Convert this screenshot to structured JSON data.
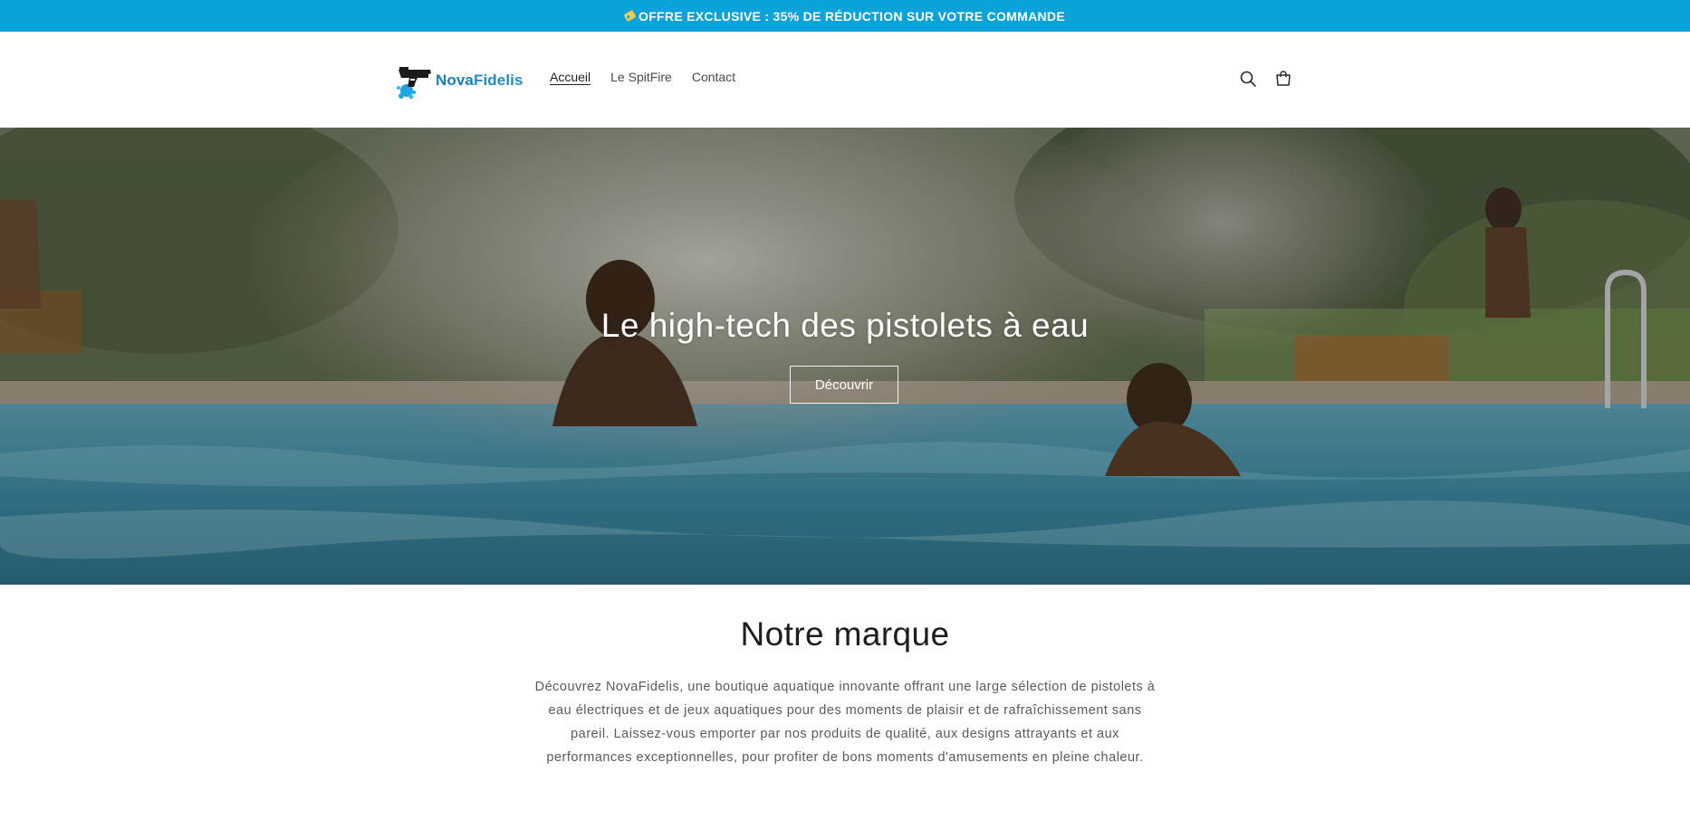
{
  "announcement": {
    "icon": "price-tag-icon",
    "text": "OFFRE EXCLUSIVE : 35% DE RÉDUCTION SUR VOTRE COMMANDE"
  },
  "header": {
    "logo": {
      "text_part1": "Nova",
      "text_part2": "Fidelis"
    },
    "nav": [
      {
        "label": "Accueil",
        "active": true
      },
      {
        "label": "Le SpitFire",
        "active": false
      },
      {
        "label": "Contact",
        "active": false
      }
    ],
    "icons": [
      "search-icon",
      "cart-icon"
    ]
  },
  "hero": {
    "title": "Le high-tech des pistolets à eau",
    "button_label": "Découvrir"
  },
  "brand": {
    "title": "Notre marque",
    "text": "Découvrez NovaFidelis, une boutique aquatique innovante offrant une large sélection de pistolets à eau électriques et de jeux aquatiques pour des moments de plaisir et de rafraîchissement sans pareil. Laissez-vous emporter par nos produits de qualité, aux designs attrayants et aux performances exceptionnelles, pour profiter de bons moments d'amusements en pleine chaleur."
  },
  "colors": {
    "announcement_bg": "#0aa3d9",
    "brand_blue": "#1d8fc7"
  }
}
